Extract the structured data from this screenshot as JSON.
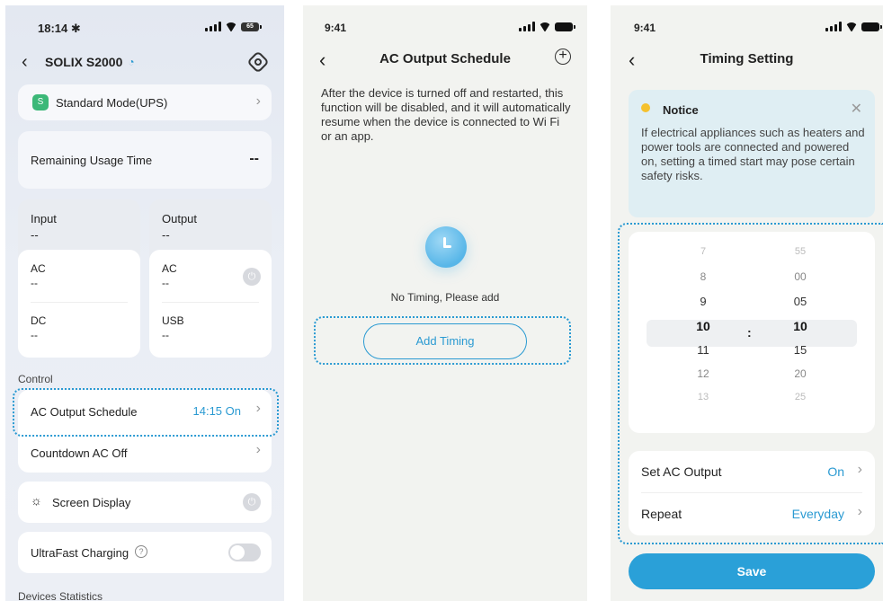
{
  "screen1": {
    "status": {
      "time": "18:14 ✱",
      "battery": "65"
    },
    "device_name": "SOLIX S2000",
    "mode": {
      "label": "Standard Mode(UPS)",
      "icon_letter": "S"
    },
    "remaining": {
      "label": "Remaining Usage Time",
      "value": "--"
    },
    "input": {
      "label": "Input",
      "value": "--",
      "ac_label": "AC",
      "ac_value": "--",
      "dc_label": "DC",
      "dc_value": "--"
    },
    "output": {
      "label": "Output",
      "value": "--",
      "ac_label": "AC",
      "ac_value": "--",
      "usb_label": "USB",
      "usb_value": "--"
    },
    "control_label": "Control",
    "ac_schedule": {
      "label": "AC Output Schedule",
      "value": "14:15 On"
    },
    "countdown": {
      "label": "Countdown AC Off"
    },
    "screen_display": {
      "label": "Screen Display"
    },
    "ultrafast": {
      "label": "UltraFast Charging"
    },
    "devices_statistics": "Devices Statistics"
  },
  "screen2": {
    "status": {
      "time": "9:41"
    },
    "title": "AC Output Schedule",
    "description": "After the device is turned off and restarted, this function will be disabled, and it will automatically resume when the device is connected to Wi Fi or an app.",
    "empty_text": "No Timing, Please add",
    "add_button": "Add Timing"
  },
  "screen3": {
    "status": {
      "time": "9:41"
    },
    "title": "Timing Setting",
    "notice": {
      "title": "Notice",
      "body": "If electrical appliances such as heaters and power tools are connected and powered on, setting a timed start may pose certain safety risks."
    },
    "hours": [
      "7",
      "8",
      "9",
      "10",
      "11",
      "12",
      "13"
    ],
    "minutes": [
      "55",
      "00",
      "05",
      "10",
      "15",
      "20",
      "25"
    ],
    "separator": ":",
    "set_ac_output": {
      "label": "Set AC Output",
      "value": "On"
    },
    "repeat": {
      "label": "Repeat",
      "value": "Everyday"
    },
    "save_button": "Save"
  },
  "colors": {
    "accent": "#2a9ad2",
    "save": "#2aa0d8",
    "mode_green": "#3cb878"
  }
}
